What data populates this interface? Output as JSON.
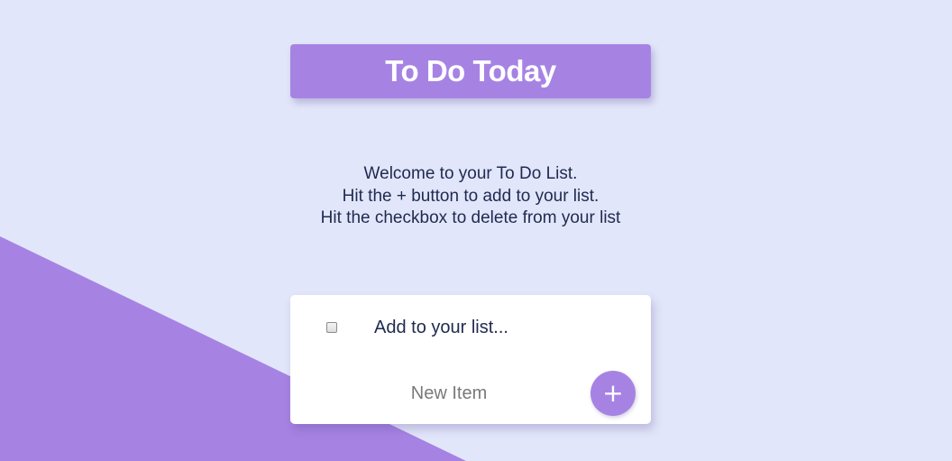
{
  "header": {
    "title": "To Do Today"
  },
  "intro": {
    "line1": "Welcome to your To Do List.",
    "line2": "Hit the + button to add to your list.",
    "line3": "Hit the checkbox to delete from your list"
  },
  "list": {
    "items": [
      {
        "text": "Add to your list...",
        "checked": false
      }
    ]
  },
  "form": {
    "placeholder": "New Item",
    "value": "",
    "add_label": "+"
  },
  "colors": {
    "background": "#E2E6FA",
    "accent": "#A683E3",
    "text": "#1E2A4F",
    "card": "#FFFFFF"
  }
}
